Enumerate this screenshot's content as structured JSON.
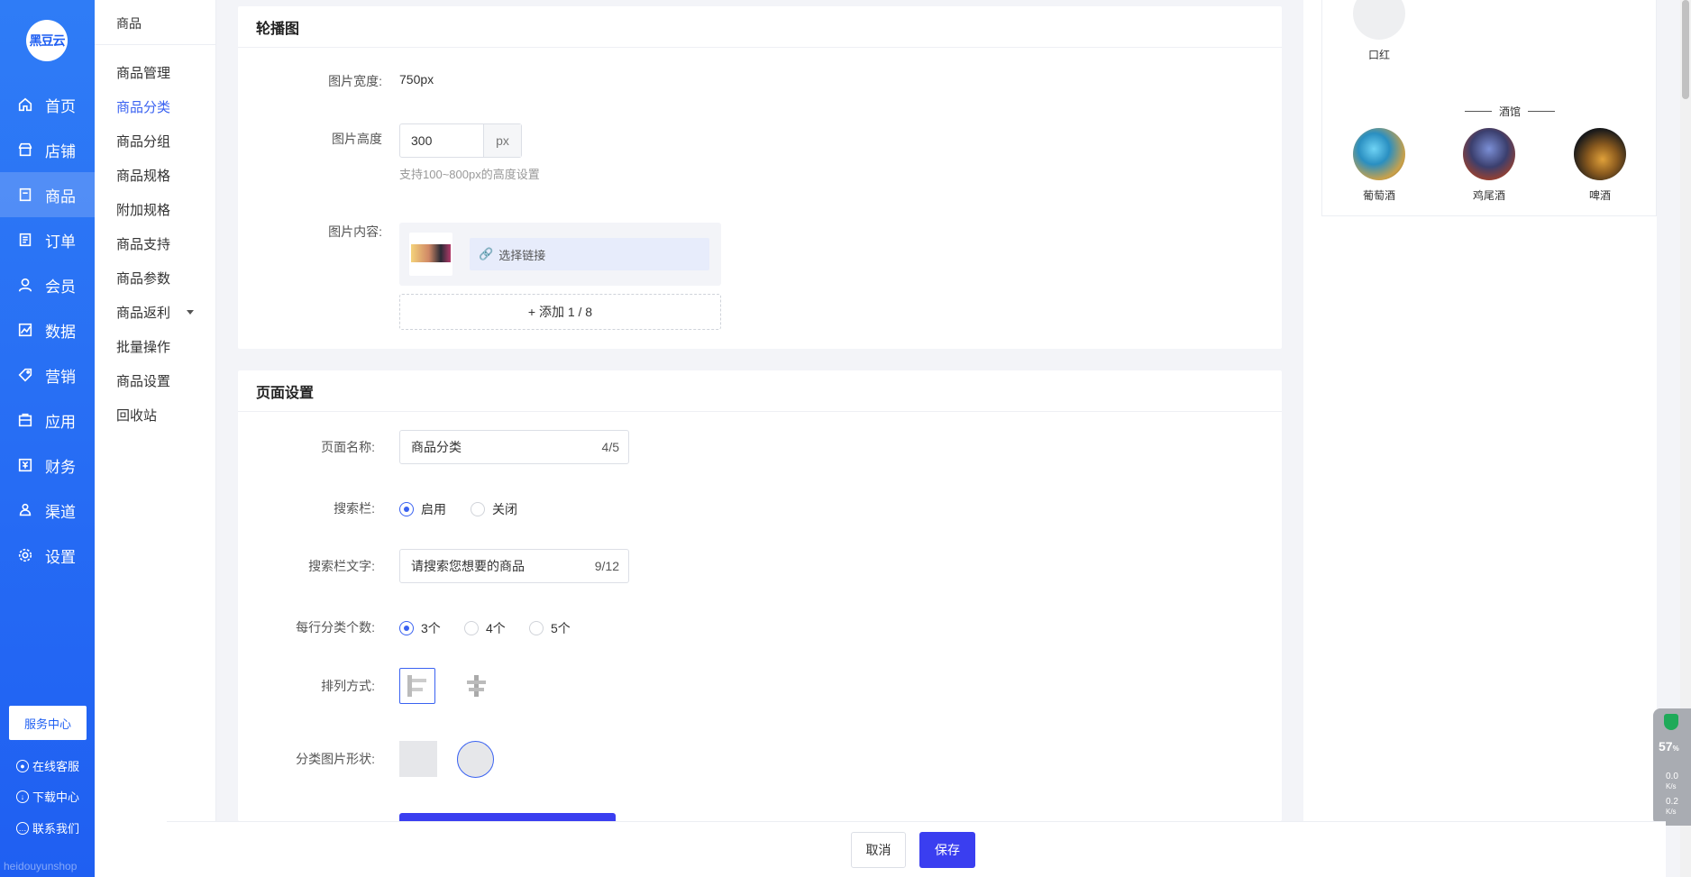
{
  "brand": {
    "logo_text": "黑豆云",
    "watermark": "heidouyunshop",
    "accent": "#1f5ff2",
    "primary_button": "#3a3ef0",
    "link_color": "#3a62f1"
  },
  "main_nav": [
    {
      "label": "首页",
      "icon": "home-icon"
    },
    {
      "label": "店铺",
      "icon": "store-icon"
    },
    {
      "label": "商品",
      "icon": "goods-icon",
      "active": true
    },
    {
      "label": "订单",
      "icon": "order-icon"
    },
    {
      "label": "会员",
      "icon": "member-icon"
    },
    {
      "label": "数据",
      "icon": "chart-icon"
    },
    {
      "label": "营销",
      "icon": "tag-icon"
    },
    {
      "label": "应用",
      "icon": "app-icon"
    },
    {
      "label": "财务",
      "icon": "finance-icon"
    },
    {
      "label": "渠道",
      "icon": "channel-icon"
    },
    {
      "label": "设置",
      "icon": "gear-icon"
    }
  ],
  "sidebar_bottom": {
    "service_center": "服务中心",
    "online_service": "在线客服",
    "download_center": "下载中心",
    "contact_us": "联系我们"
  },
  "sub_nav": {
    "title": "商品",
    "items": [
      "商品管理",
      "商品分类",
      "商品分组",
      "商品规格",
      "附加规格",
      "商品支持",
      "商品参数",
      "商品返利",
      "批量操作",
      "商品设置",
      "回收站"
    ],
    "active_index": 1
  },
  "carousel": {
    "title": "轮播图",
    "width_label": "图片宽度:",
    "width_value": "750px",
    "height_label": "图片高度",
    "height_value": "300",
    "height_unit": "px",
    "height_hint": "支持100~800px的高度设置",
    "content_label": "图片内容:",
    "select_link": "选择链接",
    "add_button": "+ 添加 1 / 8"
  },
  "page_settings": {
    "title": "页面设置",
    "name_label": "页面名称:",
    "name_value": "商品分类",
    "name_count": "4/5",
    "search_label": "搜索栏:",
    "search_options": [
      "启用",
      "关闭"
    ],
    "search_selected": 0,
    "search_text_label": "搜索栏文字:",
    "search_text_value": "请搜索您想要的商品",
    "search_text_count": "9/12",
    "per_row_label": "每行分类个数:",
    "per_row_options": [
      "3个",
      "4个",
      "5个"
    ],
    "per_row_selected": 0,
    "arrange_label": "排列方式:",
    "shape_label": "分类图片形状:"
  },
  "preview": {
    "top_item": "口红",
    "group_title": "酒馆",
    "items": [
      "葡萄酒",
      "鸡尾酒",
      "啤酒"
    ]
  },
  "widget": {
    "percent": "57",
    "percent_unit": "%",
    "up_speed": "0.0",
    "down_speed": "0.2",
    "speed_unit": "K/s"
  },
  "footer": {
    "cancel": "取消",
    "save": "保存"
  }
}
